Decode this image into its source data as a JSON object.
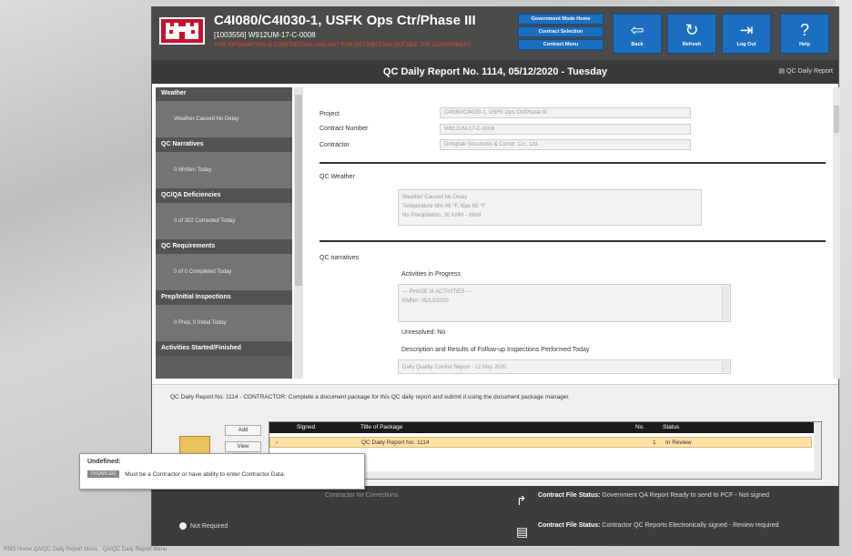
{
  "app": {
    "title": "C4I080/C4I030-1, USFK Ops Ctr/Phase III",
    "subtitle": "[1003556] W912UM-17-C-0008",
    "warning": "THIS INFORMATION IS CONFIDENTIAL AND NOT FOR DISTRIBUTION OUTSIDE THE GOVERNMENT"
  },
  "menu": {
    "government_mode_home": "Government Mode Home",
    "contract_selection": "Contract Selection",
    "contract_menu": "Contract Menu"
  },
  "toolbar": {
    "back": "Back",
    "refresh": "Refresh",
    "log_out": "Log Out",
    "help": "Help"
  },
  "header": {
    "title": "QC Daily Report No. 1114, 05/12/2020 - Tuesday",
    "link": "QC Daily Report"
  },
  "sidebar": {
    "sections": [
      {
        "head": "Weather",
        "sub": "Weather Caused No Delay"
      },
      {
        "head": "QC Narratives",
        "sub": "0 Written Today"
      },
      {
        "head": "QC/QA Deficiencies",
        "sub": "0 of 302 Corrected Today"
      },
      {
        "head": "QC Requirements",
        "sub": "0 of 0 Completed Today"
      },
      {
        "head": "Prep/Initial Inspections",
        "sub": "0 Prep, 0 Initial Today"
      },
      {
        "head": "Activities Started/Finished",
        "sub": ""
      }
    ]
  },
  "form": {
    "project_label": "Project",
    "project_value": "C4I080/C4I030-1, USFK Ops Ctr/Phase III",
    "contract_label": "Contract Number",
    "contract_value": "W912UM-17-C-0008",
    "contractor_label": "Contractor",
    "contractor_value": "Dongbak Structures & Constr. Co., Ltd.",
    "qc_weather_label": "QC Weather",
    "qc_weather_lines": [
      "Weather Caused No Delay",
      "Temperature Min 46 °F, Max 65 °F",
      "No Precipitation, 30 KMH - Wind"
    ],
    "qc_narratives_label": "QC narratives",
    "activities_label": "Activities in Progress",
    "activities_lines": [
      "--- PHASE III ACTIVITIES ---",
      "",
      "KMNA: 05/12/2020"
    ],
    "unresolved_label": "Unresolved: No",
    "followup_label": "Description and Results of Follow-up Inspections Performed Today",
    "followup_value": "Daily Quality Control Report - 12 May 2020"
  },
  "lower": {
    "message": "QC Daily Report No. 1114 - CONTRACTOR: Complete a document package for this QC daily report and submit it using the document package manager.",
    "add_button": "Add",
    "view_button": "View",
    "columns": [
      "Signed",
      "Title of Package",
      "No.",
      "Status"
    ],
    "row": {
      "title": "QC Daily Report No. 1114",
      "no": "1",
      "status": "In Review"
    }
  },
  "tooltip": {
    "title": "Undefined:",
    "badge": "DISABLED",
    "text": "Must be a Contractor or have ability to enter Contractor Data."
  },
  "bottom": {
    "not_required": "Not Required",
    "returned_text": "Contractor for Corrections",
    "status1_label": "Contract File Status:",
    "status1_text": "Government QA Report Ready to send to PCF - Not signed",
    "status2_label": "Contract File Status:",
    "status2_text": "Contractor QC Reports Electronically signed - Review required"
  },
  "footer": {
    "text": "RMS Home QA/QC Daily Report Menu · QA/QC Daily Report Menu"
  }
}
